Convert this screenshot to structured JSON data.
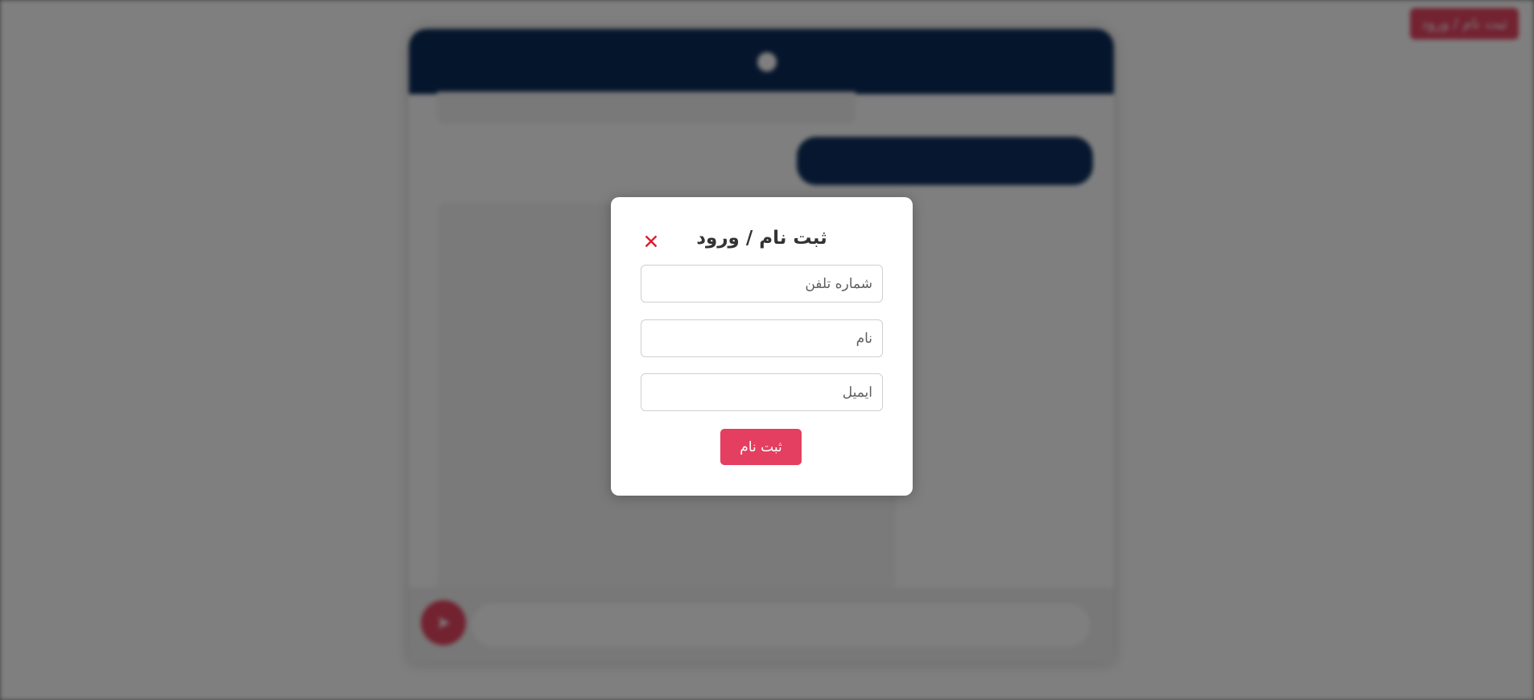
{
  "colors": {
    "accent": "#e43f60",
    "header_blue": "#0b2b58",
    "close_red": "#e01b2f",
    "overlay": "rgba(0,0,0,0.5)"
  },
  "header": {
    "title": "",
    "logo_icon": "chat-logo-icon"
  },
  "top_bar": {
    "auth_button_label": "ثبت نام / ورود"
  },
  "chat": {
    "messages": {
      "bot_top_text": "",
      "user_text": "",
      "bot_main_text": ""
    },
    "input": {
      "placeholder": ""
    },
    "send_icon": "send-icon"
  },
  "modal": {
    "title": "ثبت نام / ورود",
    "close_icon": "close-icon",
    "fields": {
      "phone": {
        "placeholder": "شماره تلفن",
        "value": ""
      },
      "name": {
        "placeholder": "نام",
        "value": ""
      },
      "email": {
        "placeholder": "ایمیل",
        "value": ""
      }
    },
    "submit_label": "ثبت نام"
  }
}
